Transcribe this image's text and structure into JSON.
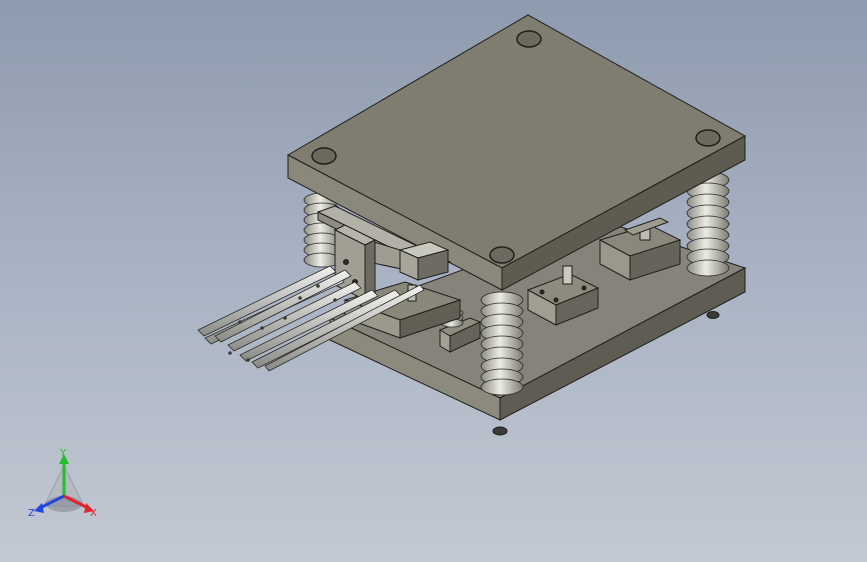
{
  "viewport": {
    "background_top": "#8e9aae",
    "background_bottom": "#c3c9d3"
  },
  "model": {
    "plate_top": "#7f7d6f",
    "plate_left": "#8a887a",
    "plate_right": "#5e5c51",
    "outline": "#1f1f1c",
    "spring_color": "#d7d6cf",
    "rod_color": "#c9c9c6"
  },
  "triad": {
    "x_label": "X",
    "y_label": "Y",
    "z_label": "Z",
    "x_color": "#e0242b",
    "y_color": "#1fbf2a",
    "z_color": "#2446e0"
  }
}
